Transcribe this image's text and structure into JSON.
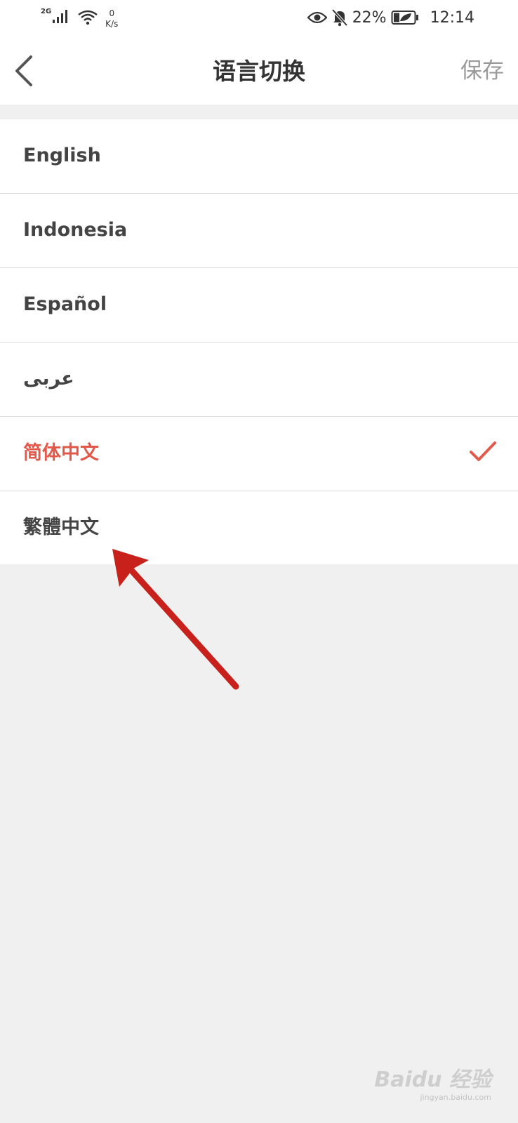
{
  "status_bar": {
    "network": "2G",
    "speed_value": "0",
    "speed_unit": "K/s",
    "battery": "22%",
    "time": "12:14"
  },
  "header": {
    "title": "语言切换",
    "save_label": "保存"
  },
  "languages": [
    {
      "label": "English"
    },
    {
      "label": "Indonesia"
    },
    {
      "label": "Español"
    },
    {
      "label": "عربى"
    },
    {
      "label": "简体中文"
    },
    {
      "label": "繁體中文"
    }
  ],
  "selected_language": "简体中文",
  "colors": {
    "accent": "#e25849",
    "annotation_arrow": "#c8201a",
    "background": "#f0f0f0"
  },
  "watermark": {
    "brand": "Baidu 经验",
    "url": "jingyan.baidu.com"
  }
}
